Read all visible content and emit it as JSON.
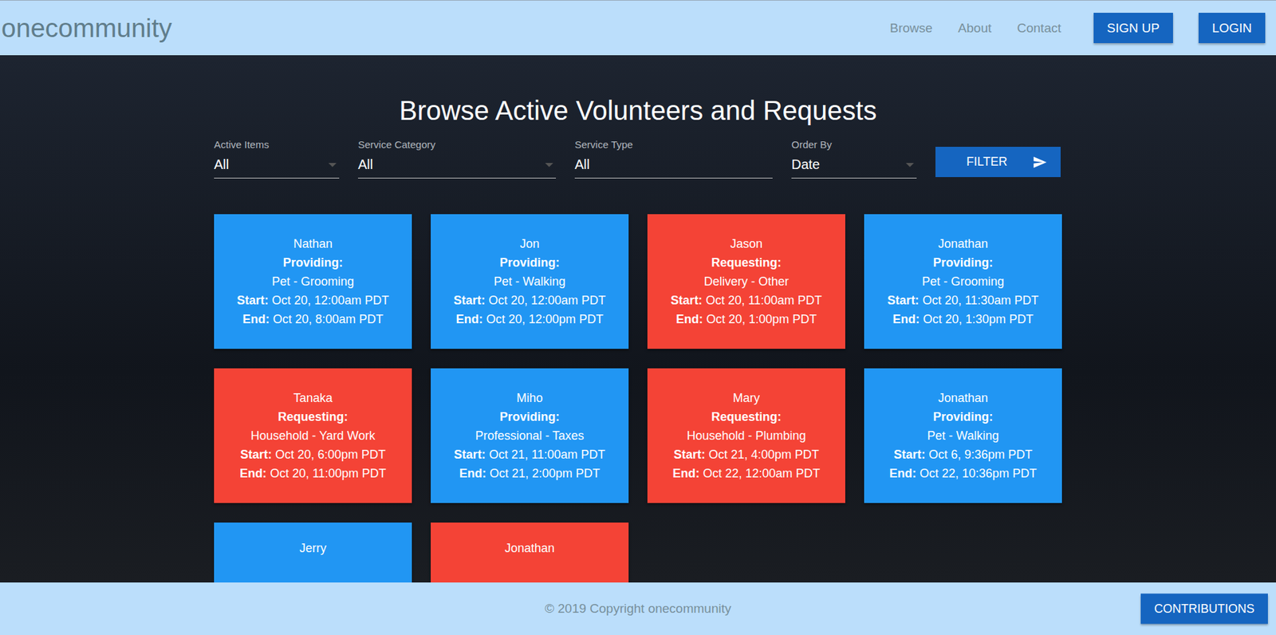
{
  "header": {
    "logo": "onecommunity",
    "nav": [
      "Browse",
      "About",
      "Contact"
    ],
    "buttons": [
      "SIGN UP",
      "LOGIN"
    ]
  },
  "page": {
    "title": "Browse Active Volunteers and Requests"
  },
  "filters": [
    {
      "label": "Active Items",
      "value": "All",
      "kind": "select"
    },
    {
      "label": "Service Category",
      "value": "All",
      "kind": "select"
    },
    {
      "label": "Service Type",
      "value": "All",
      "kind": "input"
    },
    {
      "label": "Order By",
      "value": "Date",
      "kind": "select"
    }
  ],
  "filter_button": {
    "label": "FILTER"
  },
  "labels": {
    "start": "Start:",
    "end": "End:"
  },
  "cards": [
    {
      "name": "Nathan",
      "mode": "Providing:",
      "color": "#2196f3",
      "service": "Pet - Grooming",
      "start": "Oct 20, 12:00am PDT",
      "end": "Oct 20, 8:00am PDT"
    },
    {
      "name": "Jon",
      "mode": "Providing:",
      "color": "#2196f3",
      "service": "Pet - Walking",
      "start": "Oct 20, 12:00am PDT",
      "end": "Oct 20, 12:00pm PDT"
    },
    {
      "name": "Jason",
      "mode": "Requesting:",
      "color": "#f44336",
      "service": "Delivery - Other",
      "start": "Oct 20, 11:00am PDT",
      "end": "Oct 20, 1:00pm PDT"
    },
    {
      "name": "Jonathan",
      "mode": "Providing:",
      "color": "#2196f3",
      "service": "Pet - Grooming",
      "start": "Oct 20, 11:30am PDT",
      "end": "Oct 20, 1:30pm PDT"
    },
    {
      "name": "Tanaka",
      "mode": "Requesting:",
      "color": "#f44336",
      "service": "Household - Yard Work",
      "start": "Oct 20, 6:00pm PDT",
      "end": "Oct 20, 11:00pm PDT"
    },
    {
      "name": "Miho",
      "mode": "Providing:",
      "color": "#2196f3",
      "service": "Professional - Taxes",
      "start": "Oct 21, 11:00am PDT",
      "end": "Oct 21, 2:00pm PDT"
    },
    {
      "name": "Mary",
      "mode": "Requesting:",
      "color": "#f44336",
      "service": "Household - Plumbing",
      "start": "Oct 21, 4:00pm PDT",
      "end": "Oct 22, 12:00am PDT"
    },
    {
      "name": "Jonathan",
      "mode": "Providing:",
      "color": "#2196f3",
      "service": "Pet - Walking",
      "start": "Oct 6, 9:36pm PDT",
      "end": "Oct 22, 10:36pm PDT"
    },
    {
      "name": "Jerry",
      "color": "#2196f3"
    },
    {
      "name": "Jonathan",
      "color": "#f44336"
    }
  ],
  "footer": {
    "copyright": "© 2019 Copyright onecommunity",
    "button": "CONTRIBUTIONS"
  }
}
